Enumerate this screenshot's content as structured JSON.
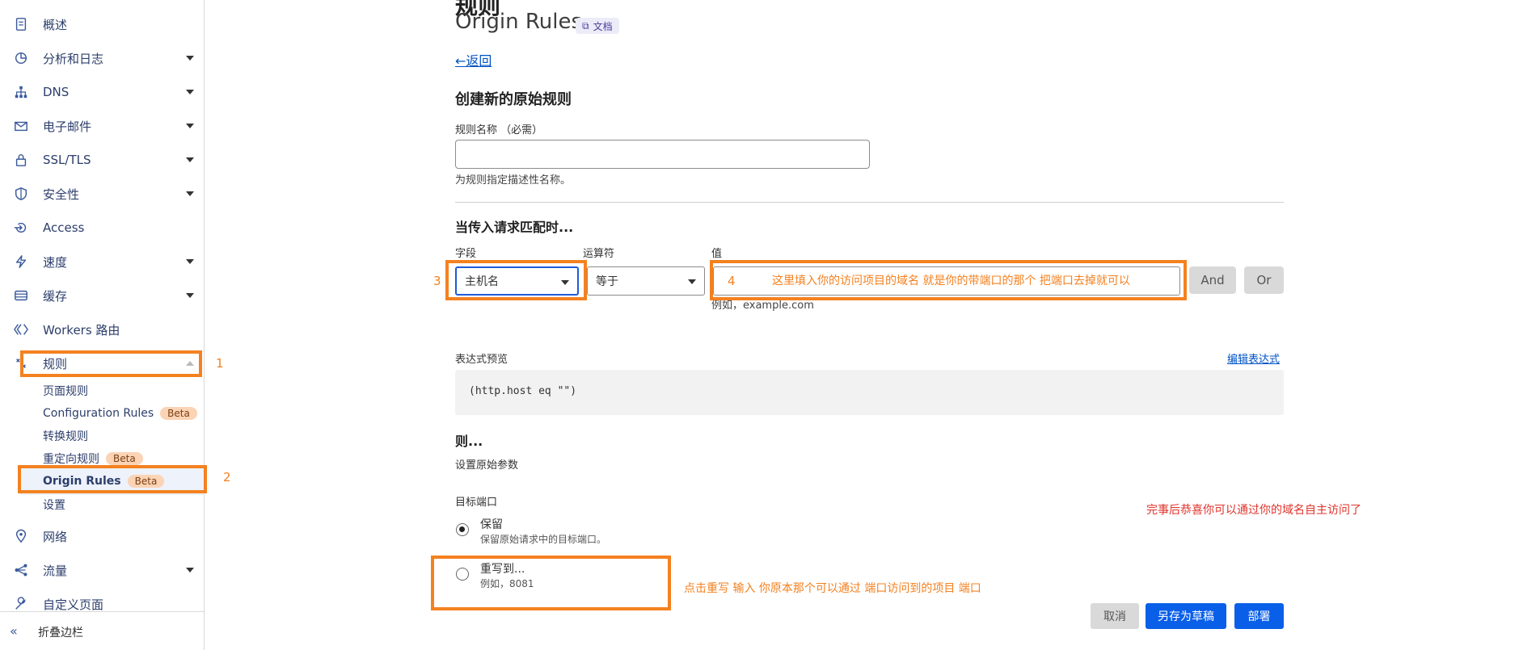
{
  "sidebar": {
    "items": [
      {
        "label": "概述",
        "icon": "document-icon",
        "caret": "none"
      },
      {
        "label": "分析和日志",
        "icon": "chart-pie-icon",
        "caret": "down"
      },
      {
        "label": "DNS",
        "icon": "network-tree-icon",
        "caret": "down"
      },
      {
        "label": "电子邮件",
        "icon": "mail-icon",
        "caret": "down"
      },
      {
        "label": "SSL/TLS",
        "icon": "lock-icon",
        "caret": "down"
      },
      {
        "label": "安全性",
        "icon": "shield-icon",
        "caret": "down"
      },
      {
        "label": "Access",
        "icon": "access-icon",
        "caret": "none"
      },
      {
        "label": "速度",
        "icon": "lightning-icon",
        "caret": "down"
      },
      {
        "label": "缓存",
        "icon": "cache-icon",
        "caret": "down"
      },
      {
        "label": "Workers 路由",
        "icon": "workers-icon",
        "caret": "none"
      },
      {
        "label": "规则",
        "icon": "rules-icon",
        "caret": "up"
      }
    ],
    "sub_items": [
      {
        "label": "页面规则",
        "badge": ""
      },
      {
        "label": "Configuration Rules",
        "badge": "Beta"
      },
      {
        "label": "转换规则",
        "badge": ""
      },
      {
        "label": "重定向规则",
        "badge": "Beta"
      },
      {
        "label": "Origin Rules",
        "badge": "Beta"
      },
      {
        "label": "设置",
        "badge": ""
      }
    ],
    "items_after": [
      {
        "label": "网络",
        "icon": "location-pin-icon",
        "caret": "none"
      },
      {
        "label": "流量",
        "icon": "traffic-icon",
        "caret": "down"
      },
      {
        "label": "自定义页面",
        "icon": "wrench-icon",
        "caret": "none"
      }
    ],
    "collapse_label": "折叠边栏",
    "collapse_icon": "«"
  },
  "header": {
    "top_title": "规则",
    "title": "Origin Rules",
    "doc_label": "文档",
    "doc_icon": "⧉",
    "back_label": "←返回"
  },
  "form": {
    "section_title": "创建新的原始规则",
    "rule_name_label": "规则名称 （必需）",
    "rule_name_value": "",
    "rule_name_hint": "为规则指定描述性名称。",
    "match_title": "当传入请求匹配时...",
    "field_label": "字段",
    "field_value": "主机名",
    "operator_label": "运算符",
    "operator_value": "等于",
    "value_label": "值",
    "value_hint": "例如，example.com",
    "and_label": "And",
    "or_label": "Or",
    "expr_label": "表达式预览",
    "edit_expr_label": "编辑表达式",
    "expr_value": "(http.host eq \"\")",
    "then_title": "则...",
    "then_sub": "设置原始参数",
    "port_label": "目标端口",
    "radio_keep": "保留",
    "radio_keep_hint": "保留原始请求中的目标端口。",
    "radio_rewrite": "重写到...",
    "radio_rewrite_hint": "例如，8081",
    "cancel_label": "取消",
    "draft_label": "另存为草稿",
    "deploy_label": "部署"
  },
  "annotations": {
    "n1": "1",
    "n2": "2",
    "n3": "3",
    "n4": "4",
    "value_note": "这里填入你的访问项目的域名 就是你的带端口的那个 把端口去掉就可以",
    "rewrite_note": "点击重写     输入 你原本那个可以通过 端口访问到的项目  端口",
    "done_note": "完事后恭喜你可以通过你的域名自主访问了"
  },
  "colors": {
    "annotation": "#f48120",
    "note_red": "#e0332c",
    "primary_button": "#0a5fe8",
    "link": "#0051c3"
  }
}
